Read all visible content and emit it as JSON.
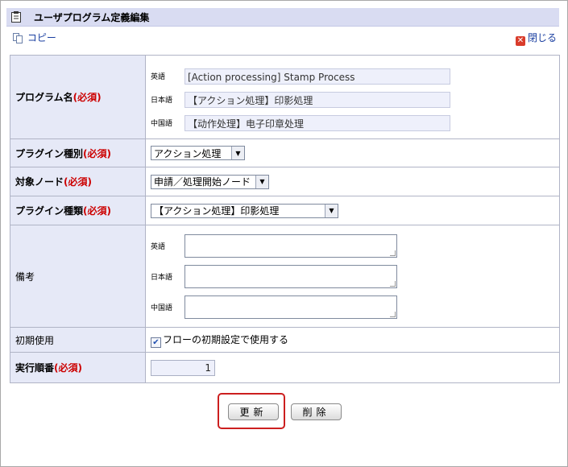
{
  "window": {
    "title": "ユーザプログラム定義編集"
  },
  "toolbar": {
    "copy_label": "コピー",
    "close_label": "閉じる"
  },
  "form": {
    "program_name": {
      "label": "プログラム名",
      "required": "(必須)",
      "rows": [
        {
          "lang": "英語",
          "value": "[Action processing] Stamp Process"
        },
        {
          "lang": "日本語",
          "value": "【アクション処理】印影処理"
        },
        {
          "lang": "中国語",
          "value": "【动作处理】电子印章处理"
        }
      ]
    },
    "plugin_category": {
      "label": "プラグイン種別",
      "required": "(必須)",
      "selected": "アクション処理"
    },
    "target_node": {
      "label": "対象ノード",
      "required": "(必須)",
      "selected": "申請／処理開始ノード"
    },
    "plugin_type": {
      "label": "プラグイン種類",
      "required": "(必須)",
      "selected": "【アクション処理】印影処理"
    },
    "remarks": {
      "label": "備考",
      "rows": [
        {
          "lang": "英語"
        },
        {
          "lang": "日本語"
        },
        {
          "lang": "中国語"
        }
      ]
    },
    "initial_use": {
      "label": "初期使用",
      "checkbox_label": "フローの初期設定で使用する",
      "checked": true
    },
    "exec_order": {
      "label": "実行順番",
      "required": "(必須)",
      "value": "1"
    }
  },
  "buttons": {
    "update": "更新",
    "delete": "削除"
  },
  "colors": {
    "title_bg": "#d9dcf2",
    "label_bg": "#e6e9f7",
    "required": "#cc0000",
    "highlight": "#cc1f1f"
  }
}
